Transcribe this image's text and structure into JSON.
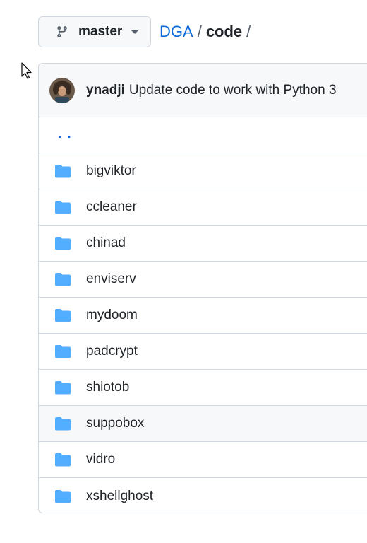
{
  "branch": {
    "name": "master",
    "icon": "git-branch-icon"
  },
  "breadcrumb": {
    "repo": "DGA",
    "separator": "/",
    "folder": "code",
    "trailing": "/"
  },
  "commit": {
    "author": "ynadji",
    "message": "Update code to work with Python 3",
    "avatar_icon": "avatar-image"
  },
  "parent": {
    "label": ". ."
  },
  "files": [
    {
      "name": "bigviktor"
    },
    {
      "name": "ccleaner"
    },
    {
      "name": "chinad"
    },
    {
      "name": "enviserv"
    },
    {
      "name": "mydoom"
    },
    {
      "name": "padcrypt"
    },
    {
      "name": "shiotob"
    },
    {
      "name": "suppobox"
    },
    {
      "name": "vidro"
    },
    {
      "name": "xshellghost"
    }
  ],
  "colors": {
    "link": "#0969da",
    "folder": "#54aeff",
    "border": "#d0d7de",
    "hover": "#f6f8fa"
  }
}
